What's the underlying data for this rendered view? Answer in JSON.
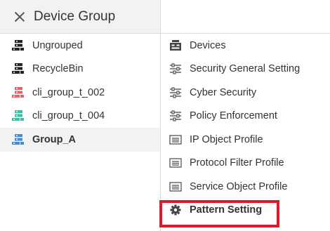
{
  "header": {
    "title": "Device Group"
  },
  "left_items": [
    {
      "label": "Ungrouped",
      "icon": "device-stack-icon",
      "color": "#222222"
    },
    {
      "label": "RecycleBin",
      "icon": "device-stack-icon",
      "color": "#222222"
    },
    {
      "label": "cli_group_t_002",
      "icon": "device-stack-icon",
      "color": "#e8606a"
    },
    {
      "label": "cli_group_t_004",
      "icon": "device-stack-icon",
      "color": "#2ec4a6"
    },
    {
      "label": "Group_A",
      "icon": "device-stack-icon",
      "color": "#3b8fd9",
      "selected": true
    }
  ],
  "right_items": [
    {
      "label": "Devices",
      "icon": "devices-icon"
    },
    {
      "label": "Security General Setting",
      "icon": "sliders-icon"
    },
    {
      "label": "Cyber Security",
      "icon": "sliders-icon"
    },
    {
      "label": "Policy Enforcement",
      "icon": "sliders-icon"
    },
    {
      "label": "IP Object Profile",
      "icon": "profile-card-icon"
    },
    {
      "label": "Protocol Filter Profile",
      "icon": "profile-card-icon"
    },
    {
      "label": "Service Object Profile",
      "icon": "profile-card-icon"
    },
    {
      "label": "Pattern Setting",
      "icon": "gear-icon",
      "bold": true,
      "highlighted": true
    }
  ],
  "colors": {
    "highlight": "#e0182a",
    "header_bg": "#f2f2f2",
    "selected_bg": "#f2f2f2",
    "divider": "#dcdcdc"
  }
}
